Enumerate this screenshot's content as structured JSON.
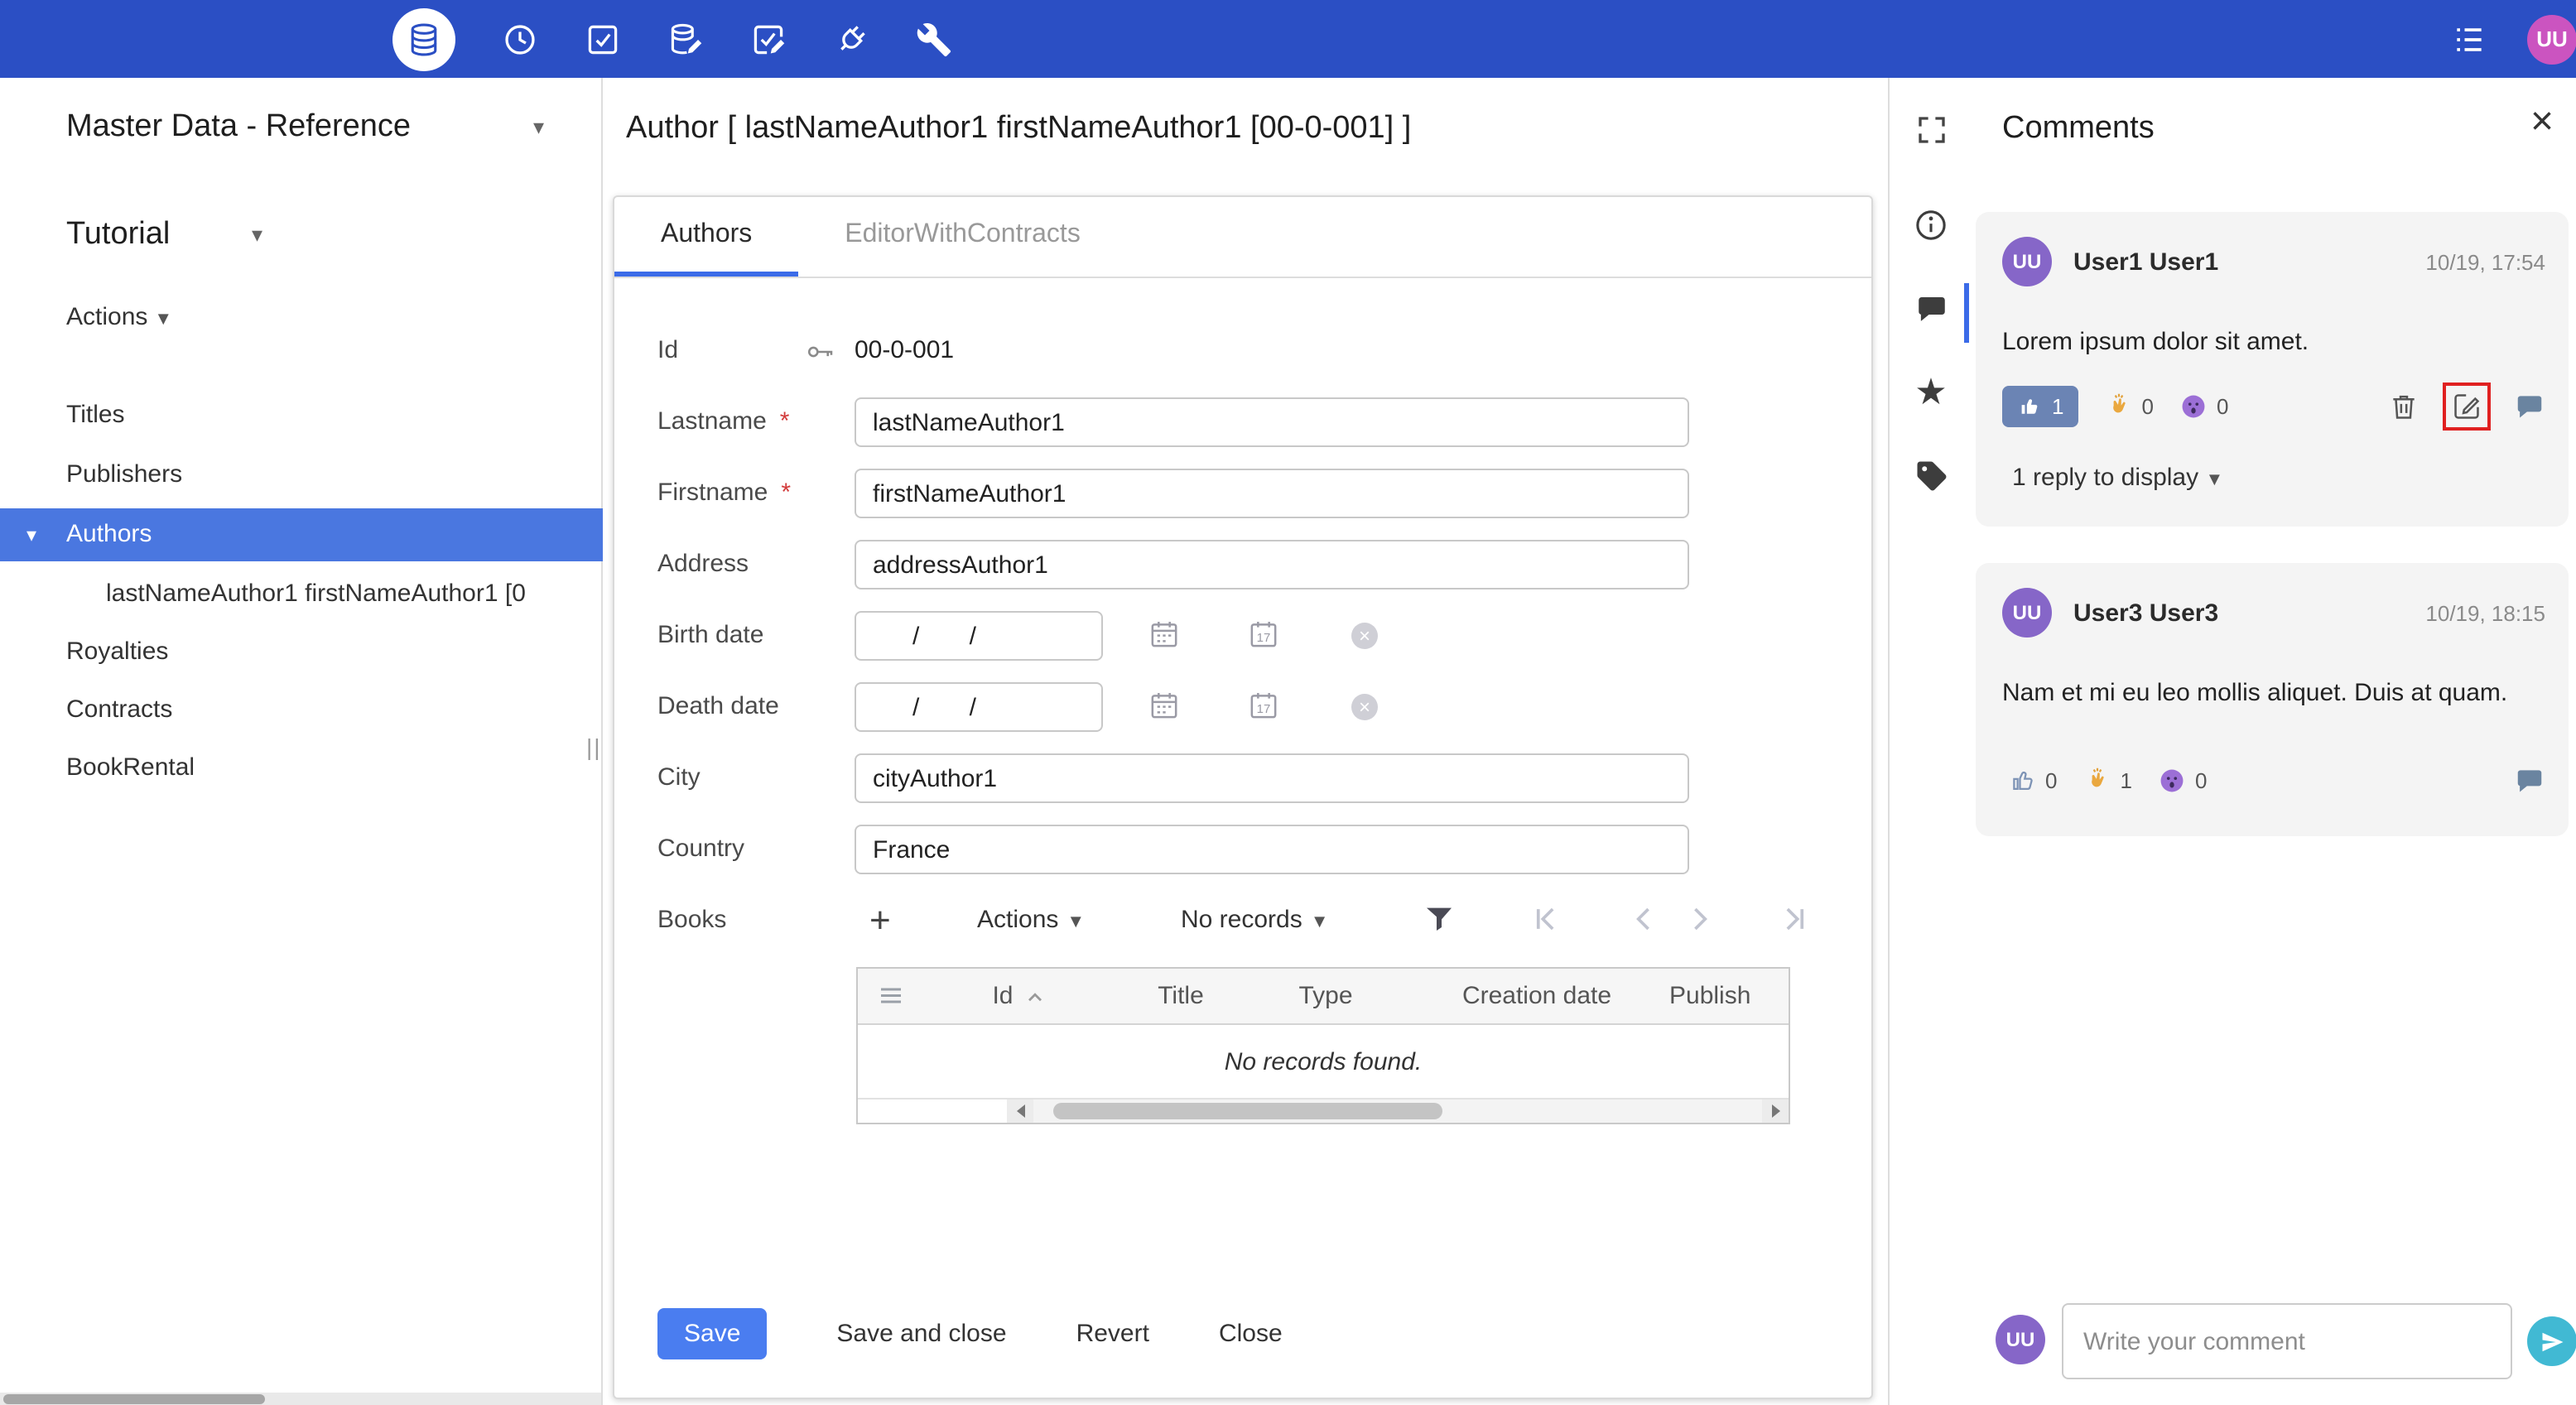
{
  "colors": {
    "topbar": "#2b4fc4",
    "primary_button": "#4a7df0",
    "sidebar_selection": "#4a77e0",
    "tab_underline": "#3b6be8",
    "like_chip": "#6b84b4",
    "send_button": "#41b9d3",
    "topbar_avatar": "#cb54c0",
    "comment_avatar": "#8666c8",
    "annotation_box": "#e02020"
  },
  "topbar": {
    "avatar_initials": "UU",
    "icons": [
      "database",
      "history-clock",
      "tasks-check",
      "database-edit",
      "tasks-edit",
      "plug",
      "wrench",
      "list"
    ]
  },
  "sidebar": {
    "app_title": "Master Data - Reference",
    "workspace": "Tutorial",
    "actions_label": "Actions",
    "items": [
      {
        "label": "Titles"
      },
      {
        "label": "Publishers"
      },
      {
        "label": "Authors"
      },
      {
        "label": "lastNameAuthor1 firstNameAuthor1 [0"
      },
      {
        "label": "Royalties"
      },
      {
        "label": "Contracts"
      },
      {
        "label": "BookRental"
      }
    ]
  },
  "main": {
    "title": "Author [ lastNameAuthor1 firstNameAuthor1 [00-0-001] ]",
    "tabs": [
      {
        "label": "Authors"
      },
      {
        "label": "EditorWithContracts"
      }
    ],
    "form": {
      "id": {
        "label": "Id",
        "value": "00-0-001"
      },
      "lastname": {
        "label": "Lastname",
        "required": "*",
        "value": "lastNameAuthor1"
      },
      "firstname": {
        "label": "Firstname",
        "required": "*",
        "value": "firstNameAuthor1"
      },
      "address": {
        "label": "Address",
        "value": "addressAuthor1"
      },
      "birth_date": {
        "label": "Birth date",
        "value": "/ /"
      },
      "death_date": {
        "label": "Death date",
        "value": "/ /"
      },
      "city": {
        "label": "City",
        "value": "cityAuthor1"
      },
      "country": {
        "label": "Country",
        "value": "France"
      },
      "books": {
        "label": "Books",
        "add_label": "+",
        "actions_label": "Actions",
        "records_label": "No records"
      }
    },
    "table": {
      "columns": [
        "Id",
        "Title",
        "Type",
        "Creation date",
        "Publish"
      ],
      "empty_text": "No records found."
    },
    "buttons": {
      "save": "Save",
      "save_and_close": "Save and close",
      "revert": "Revert",
      "close": "Close"
    }
  },
  "comments": {
    "title": "Comments",
    "items": [
      {
        "initials": "UU",
        "author": "User1 User1",
        "time": "10/19, 17:54",
        "text": "Lorem ipsum dolor sit amet.",
        "like_count": "1",
        "clap_count": "0",
        "wow_count": "0",
        "replies_label": "1 reply to display"
      },
      {
        "initials": "UU",
        "author": "User3 User3",
        "time": "10/19, 18:15",
        "text": "Nam et mi eu leo mollis aliquet. Duis at quam.",
        "like_count": "0",
        "clap_count": "1",
        "wow_count": "0"
      }
    ],
    "input_placeholder": "Write your comment",
    "input_avatar": "UU"
  }
}
